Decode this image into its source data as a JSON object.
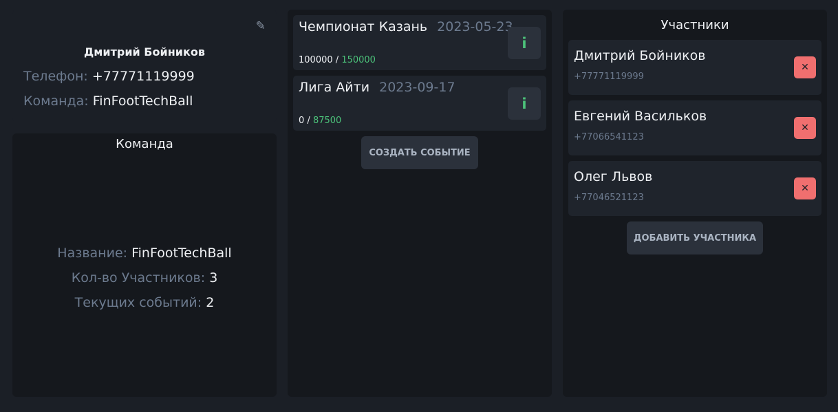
{
  "profile": {
    "edit_icon": "pencil-icon",
    "name": "Дмитрий Бойников",
    "phone_label": "Телефон:",
    "phone": "+77771119999",
    "team_label": "Команда:",
    "team": "FinFootTechBall"
  },
  "team": {
    "title": "Команда",
    "name_label": "Название:",
    "name": "FinFootTechBall",
    "members_label": "Кол-во Участников:",
    "members": "3",
    "events_label": "Текущих событий:",
    "events": "2"
  },
  "events": {
    "items": [
      {
        "title": "Чемпионат Казань",
        "date": "2023-05-23",
        "raised": "100000",
        "separator": "/",
        "goal": "150000",
        "info_label": "i"
      },
      {
        "title": "Лига Айти",
        "date": "2023-09-17",
        "raised": "0",
        "separator": "/",
        "goal": "87500",
        "info_label": "i"
      }
    ],
    "create_label": "СОЗДАТЬ СОБЫТИЕ"
  },
  "participants": {
    "title": "Участники",
    "items": [
      {
        "name": "Дмитрий Бойников",
        "phone": "+77771119999",
        "remove_label": "✕"
      },
      {
        "name": "Евгений Васильков",
        "phone": "+77066541123",
        "remove_label": "✕"
      },
      {
        "name": "Олег Львов",
        "phone": "+77046521123",
        "remove_label": "✕"
      }
    ],
    "add_label": "ДОБАВИТЬ УЧАСТНИКА"
  },
  "colors": {
    "background": "#1b1f26",
    "card": "#15181d",
    "accent_green": "#4cc27a",
    "danger": "#f06f6f",
    "muted": "#6c7a8e"
  }
}
